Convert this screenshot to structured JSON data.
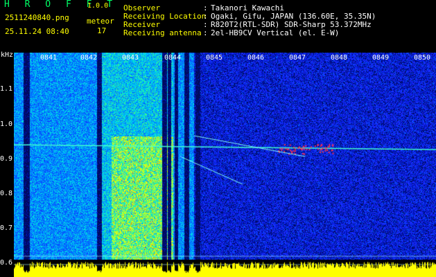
{
  "header": {
    "brand": "H R O F F T",
    "version": "1.0.0",
    "filename": "2511240840.png",
    "datetime": "25.11.24 08:40",
    "meteor_label": "meteor",
    "meteor_count": "17",
    "meta": [
      {
        "key": "Observer",
        "value": "Takanori Kawachi"
      },
      {
        "key": "Receiving Location",
        "value": "Ogaki, Gifu, JAPAN (136.60E, 35.35N)"
      },
      {
        "key": "Receiver",
        "value": "R820T2(RTL-SDR) SDR-Sharp 53.372MHz"
      },
      {
        "key": "Receiving antenna",
        "value": "2el-HB9CV Vertical (el. E-W)"
      }
    ]
  },
  "axis": {
    "y_unit": "kHz",
    "y_ticks": [
      "1.1",
      "1.0",
      "0.9",
      "0.8",
      "0.7",
      "0.6"
    ],
    "x_ticks": [
      "0841",
      "0842",
      "0843",
      "0844",
      "0845",
      "0846",
      "0847",
      "0848",
      "0849",
      "0850"
    ]
  },
  "colors": {
    "label": "#ffff00",
    "brand": "#00ff66",
    "background_noise": "#1a2cff",
    "signal_hot": "#ff2020",
    "baseline": "#ffff00"
  }
}
